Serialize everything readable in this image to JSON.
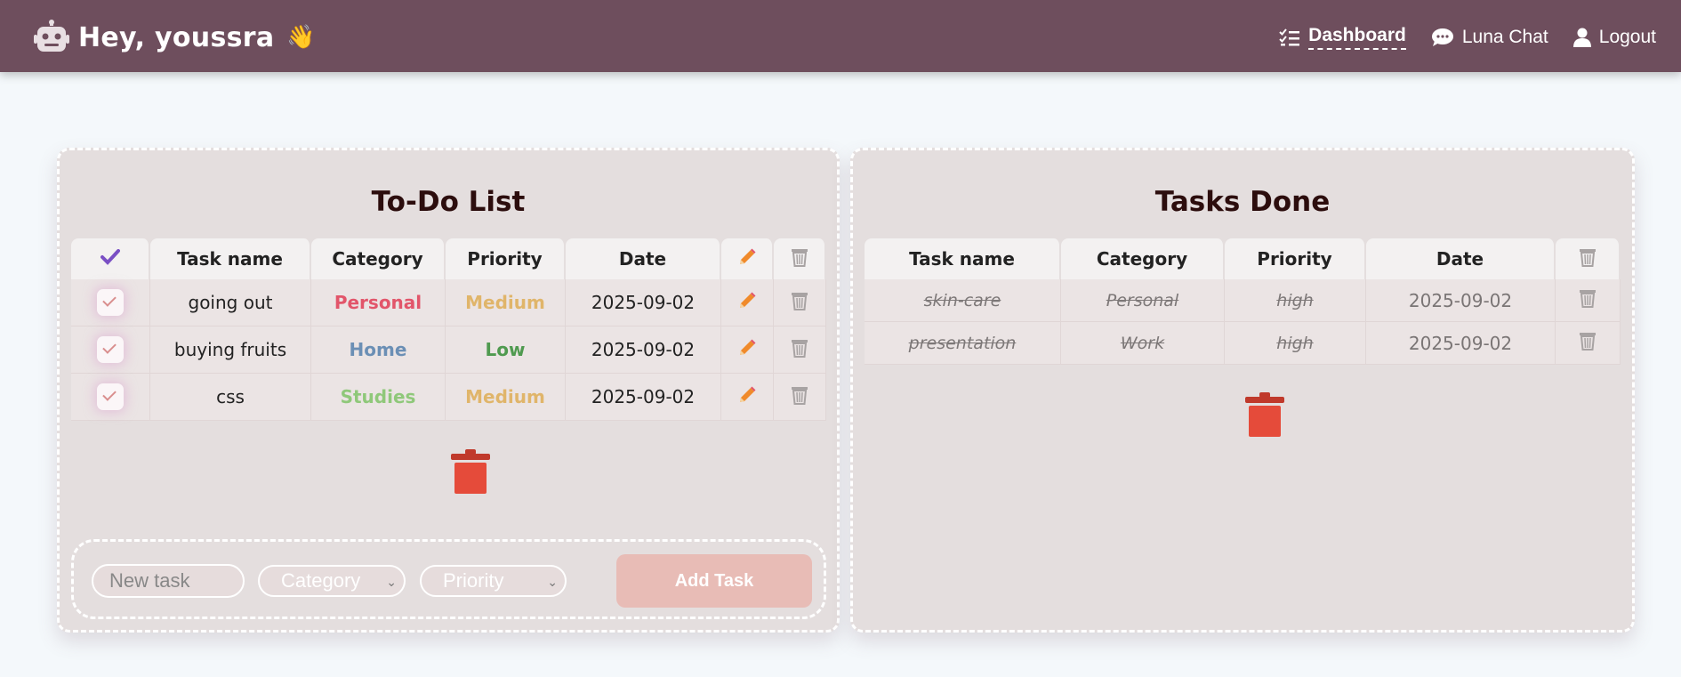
{
  "header": {
    "greeting": "Hey, youssra",
    "wave": "👋",
    "nav": [
      {
        "label": "Dashboard",
        "icon": "checklist-icon",
        "active": true
      },
      {
        "label": "Luna Chat",
        "icon": "chat-bubble-icon",
        "active": false
      },
      {
        "label": "Logout",
        "icon": "user-icon",
        "active": false
      }
    ]
  },
  "todo": {
    "title": "To-Do List",
    "columns": [
      "Task name",
      "Category",
      "Priority",
      "Date"
    ],
    "rows": [
      {
        "task": "going out",
        "category": "Personal",
        "priority": "Medium",
        "date": "2025-09-02",
        "category_color": "#e2556a",
        "priority_color": "#e0b56a"
      },
      {
        "task": "buying fruits",
        "category": "Home",
        "priority": "Low",
        "date": "2025-09-02",
        "category_color": "#6b8fb5",
        "priority_color": "#4f9a4f"
      },
      {
        "task": "css",
        "category": "Studies",
        "priority": "Medium",
        "date": "2025-09-02",
        "category_color": "#8fc87a",
        "priority_color": "#e0b56a"
      }
    ]
  },
  "done": {
    "title": "Tasks Done",
    "columns": [
      "Task name",
      "Category",
      "Priority",
      "Date"
    ],
    "rows": [
      {
        "task": "skin-care",
        "category": "Personal",
        "priority": "high",
        "date": "2025-09-02"
      },
      {
        "task": "presentation",
        "category": "Work",
        "priority": "high",
        "date": "2025-09-02"
      }
    ]
  },
  "form": {
    "task_placeholder": "New task",
    "category_placeholder": "Category",
    "priority_placeholder": "Priority",
    "add_label": "Add Task"
  },
  "colors": {
    "header_bg": "#6e4e5d",
    "panel_bg": "#e4dede",
    "trash_red": "#e54b3a",
    "pencil_orange": "#f08a2b",
    "check_purple": "#7a4fc4",
    "add_button_bg": "#e8bcb6"
  }
}
